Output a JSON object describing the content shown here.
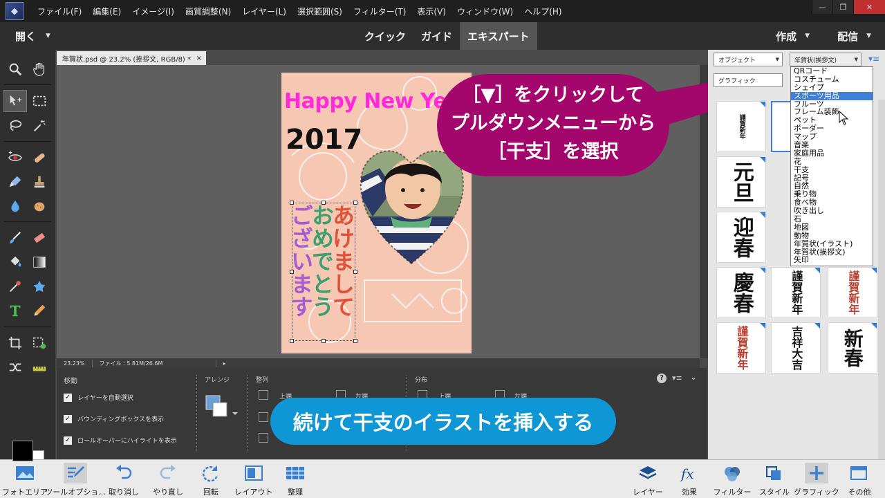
{
  "menubar": {
    "items": [
      "ファイル(F)",
      "編集(E)",
      "イメージ(I)",
      "画質調整(N)",
      "レイヤー(L)",
      "選択範囲(S)",
      "フィルター(T)",
      "表示(V)",
      "ウィンドウ(W)",
      "ヘルプ(H)"
    ]
  },
  "modebar": {
    "open_label": "開く",
    "tabs": [
      "クイック",
      "ガイド",
      "エキスパート"
    ],
    "active_tab": "エキスパート",
    "create_label": "作成",
    "share_label": "配信"
  },
  "document": {
    "tab_title": "年賀状.psd @ 23.2% (挨拶文, RGB/8) *",
    "close_glyph": "×",
    "zoom": "23.23%",
    "file_info": "ファイル : 5.81M/26.6M",
    "card": {
      "happy": "Happy New Year",
      "year": "2017",
      "greeting_cols": [
        "あけまして",
        "おめでとう",
        "ございます"
      ],
      "greeting_colors": [
        "#e0523a",
        "#f3a21c",
        "#5cbc3c",
        "#3a8fd8",
        "#a75bd0"
      ]
    }
  },
  "callout": {
    "line1": "［▼］をクリックして",
    "line2": "プルダウンメニューから",
    "line3": "［干支］を選択",
    "color": "#a4076b"
  },
  "options": {
    "move_header": "移動",
    "arrange_header": "アレンジ",
    "align_header": "整列",
    "distribute_header": "分布",
    "checkboxes": [
      "レイヤーを自動選択",
      "バウンディングボックスを表示",
      "ロールオーバーにハイライトを表示"
    ],
    "align_top": "上端",
    "align_left": "左端",
    "dist_top": "上端",
    "dist_left": "左端"
  },
  "banner": {
    "text": "続けて干支のイラストを挿入する",
    "color": "#0e97d4"
  },
  "panel": {
    "category_select": "オブジェクト",
    "subcategory_select": "年賀状(挨拶文)",
    "type_select": "グラフィック",
    "thumbs": [
      {
        "text": "謹賀新年",
        "color": "#111"
      },
      {
        "text": "元旦",
        "color": "#111"
      },
      {
        "text": "迎春",
        "color": "#111"
      },
      {
        "text": "慶春",
        "color": "#111"
      },
      {
        "text": "謹賀新年",
        "color": "#111"
      },
      {
        "text": "謹賀新年",
        "color": "#b8402e"
      },
      {
        "text": "謹賀新年",
        "color": "#c0392b"
      },
      {
        "text": "吉祥大吉",
        "color": "#111"
      },
      {
        "text": "新春",
        "color": "#111"
      }
    ]
  },
  "dropdown": {
    "items": [
      "QRコード",
      "コスチューム",
      "シェイプ",
      "スポーツ用品",
      "フルーツ",
      "フレーム装飾",
      "ペット",
      "ボーダー",
      "マップ",
      "音楽",
      "家庭用品",
      "花",
      "干支",
      "記号",
      "自然",
      "乗り物",
      "食べ物",
      "吹き出し",
      "石",
      "地図",
      "動物",
      "年賀状(イラスト)",
      "年賀状(挨拶文)",
      "矢印"
    ],
    "highlighted": "スポーツ用品"
  },
  "taskbar": {
    "left": [
      "フォトエリア",
      "ツールオプショ...",
      "取り消し",
      "やり直し",
      "回転",
      "レイアウト",
      "整理"
    ],
    "right": [
      "レイヤー",
      "効果",
      "フィルター",
      "スタイル",
      "グラフィック",
      "その他"
    ]
  }
}
